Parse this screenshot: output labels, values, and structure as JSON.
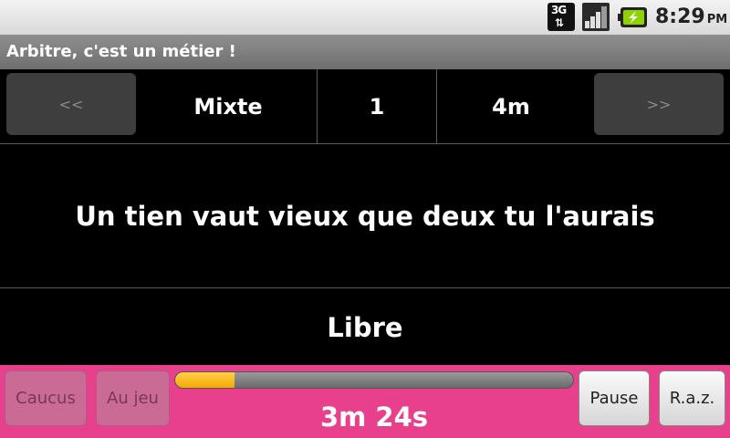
{
  "status_bar": {
    "network_label": "3G",
    "network_icon": "3g-data-icon",
    "signal_icon": "signal-strength-icon",
    "battery_icon": "battery-charging-icon",
    "time": "8:29",
    "ampm": "PM"
  },
  "app": {
    "title": "Arbitre, c'est un métier !"
  },
  "header": {
    "prev_label": "<<",
    "next_label": ">>",
    "category": "Mixte",
    "number": "1",
    "duration": "4m"
  },
  "theme": "Un tien vaut vieux que deux tu l'aurais",
  "type": "Libre",
  "controls": {
    "caucus_label": "Caucus",
    "caucus_enabled": false,
    "aujeu_label": "Au jeu",
    "aujeu_enabled": false,
    "pause_label": "Pause",
    "raz_label": "R.a.z."
  },
  "timer": {
    "elapsed_text": "3m 24s",
    "progress_fraction": 0.15
  },
  "colors": {
    "bottom_bar": "#e8408c",
    "progress_fill": "#f5b400"
  }
}
